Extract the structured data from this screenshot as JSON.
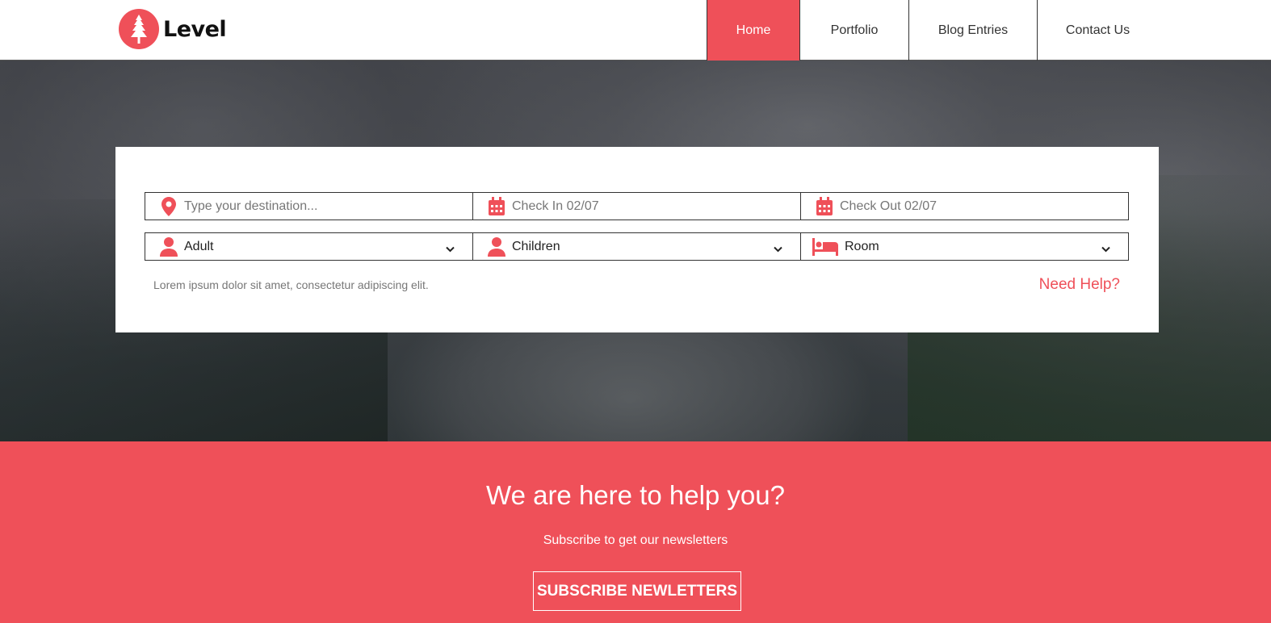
{
  "brand": {
    "name": "Level",
    "logo_icon": "pine-tree-icon",
    "accent": "#ef5059"
  },
  "nav": {
    "items": [
      {
        "label": "Home",
        "active": true
      },
      {
        "label": "Portfolio",
        "active": false
      },
      {
        "label": "Blog Entries",
        "active": false
      },
      {
        "label": "Contact Us",
        "active": false
      }
    ]
  },
  "search": {
    "destination": {
      "placeholder": "Type your destination...",
      "icon": "map-pin-icon"
    },
    "check_in": {
      "placeholder": "Check In 02/07",
      "icon": "calendar-icon"
    },
    "check_out": {
      "placeholder": "Check Out 02/07",
      "icon": "calendar-icon"
    },
    "adult": {
      "value": "Adult",
      "icon": "user-icon"
    },
    "children": {
      "value": "Children",
      "icon": "user-icon"
    },
    "room": {
      "value": "Room",
      "icon": "bed-icon"
    },
    "note": "Lorem ipsum dolor sit amet, consectetur adipiscing elit.",
    "help_label": "Need Help?"
  },
  "newsletter": {
    "title": "We are here to help you?",
    "subtitle": "Subscribe to get our newsletters",
    "button_label": "SUBSCRIBE NEWLETTERS"
  }
}
